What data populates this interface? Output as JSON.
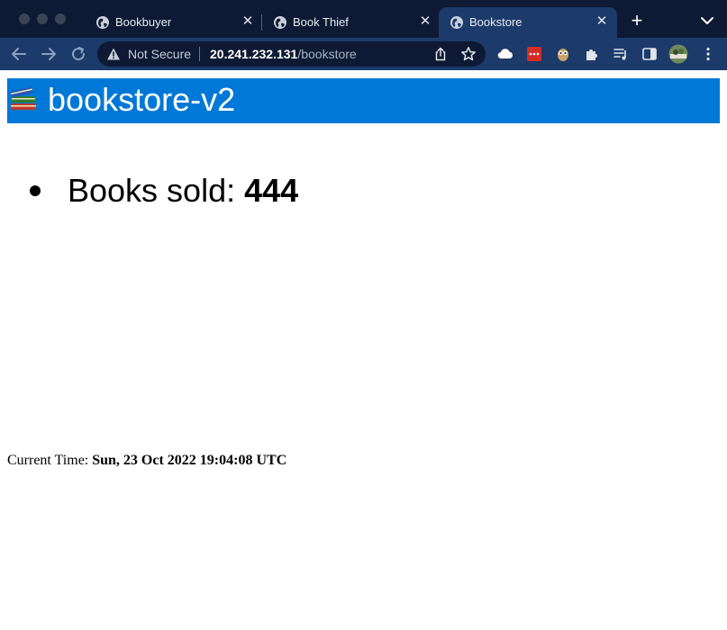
{
  "browser": {
    "tabs": [
      {
        "title": "Bookbuyer",
        "active": false
      },
      {
        "title": "Book Thief",
        "active": false
      },
      {
        "title": "Bookstore",
        "active": true
      }
    ],
    "address_bar": {
      "security_label": "Not Secure",
      "host": "20.241.232.131",
      "path": "/bookstore"
    },
    "colors": {
      "tabstrip": "#0e1a33",
      "toolbar": "#1c3a6a"
    }
  },
  "page": {
    "banner": {
      "icon": "books-icon",
      "title": "bookstore-v2",
      "color": "#0078d7"
    },
    "books_sold": {
      "label": "Books sold: ",
      "value": "444"
    },
    "current_time": {
      "label": "Current Time: ",
      "value": "Sun, 23 Oct 2022 19:04:08 UTC"
    }
  }
}
